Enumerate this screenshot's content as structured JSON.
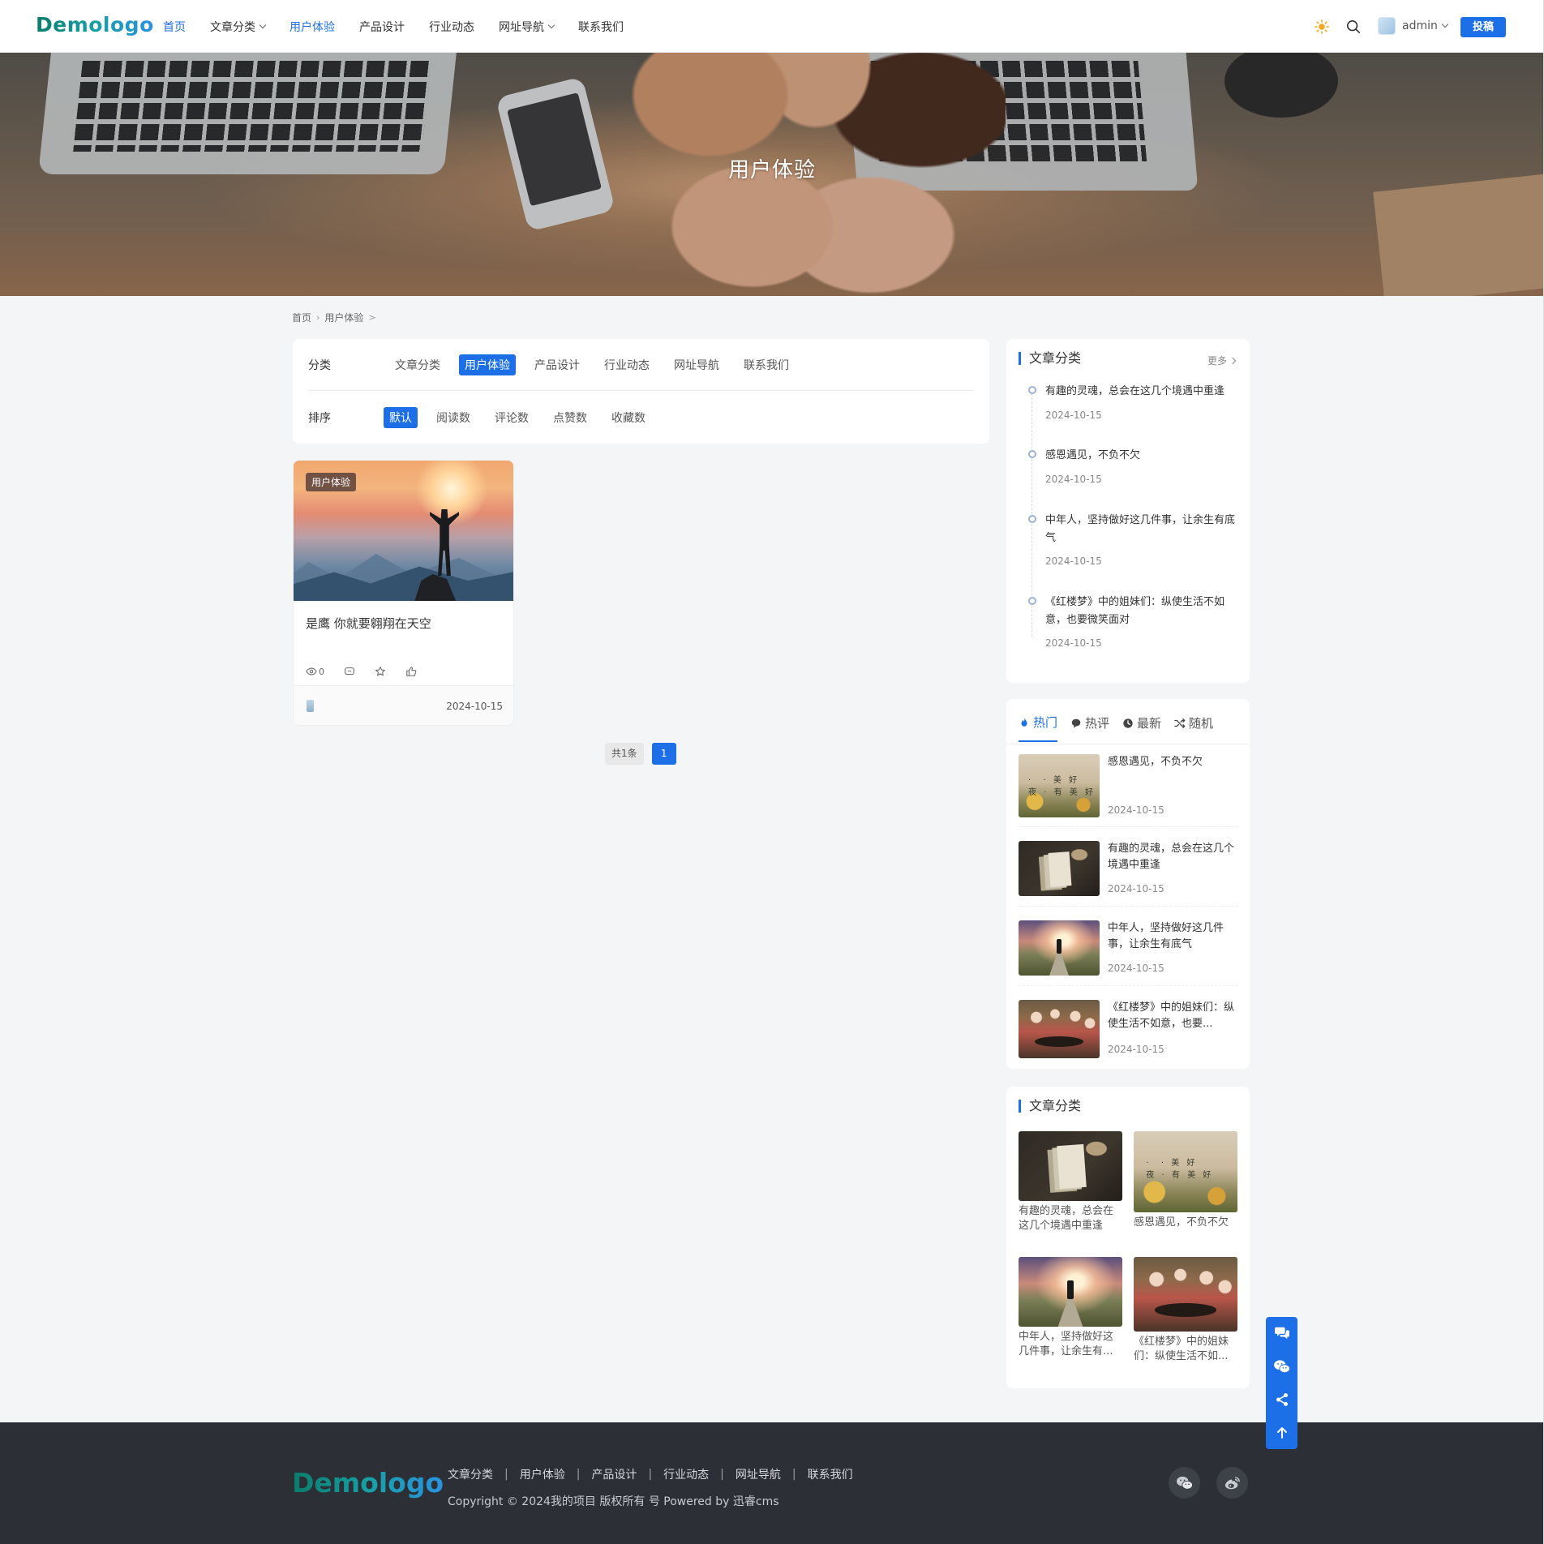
{
  "header": {
    "logo": "Demologo",
    "nav": [
      {
        "label": "首页",
        "active": false,
        "home": true,
        "dropdown": false
      },
      {
        "label": "文章分类",
        "dropdown": true
      },
      {
        "label": "用户体验",
        "active": true,
        "dropdown": false
      },
      {
        "label": "产品设计",
        "dropdown": false
      },
      {
        "label": "行业动态",
        "dropdown": false
      },
      {
        "label": "网址导航",
        "dropdown": true
      },
      {
        "label": "联系我们",
        "dropdown": false
      }
    ],
    "user": "admin",
    "submit": "投稿",
    "icons": [
      "sun-icon",
      "search-icon",
      "avatar",
      "chevron-down-icon"
    ],
    "accent": "#1d6fe8"
  },
  "banner": {
    "title": "用户体验"
  },
  "breadcrumb": {
    "home": "首页",
    "current": "用户体验",
    "trail_sep": ">"
  },
  "filter": {
    "category_label": "分类",
    "categories": [
      "文章分类",
      "用户体验",
      "产品设计",
      "行业动态",
      "网址导航",
      "联系我们"
    ],
    "category_selected": "用户体验",
    "sort_label": "排序",
    "sorts": [
      "默认",
      "阅读数",
      "评论数",
      "点赞数",
      "收藏数"
    ],
    "sort_selected": "默认"
  },
  "article": {
    "tag": "用户体验",
    "title": "是鹰 你就要翱翔在天空",
    "views": "0",
    "date": "2024-10-15"
  },
  "pagination": {
    "total": "共1条",
    "current": "1"
  },
  "sidebar": {
    "category_widget": {
      "title": "文章分类",
      "more": "更多",
      "items": [
        {
          "title": "有趣的灵魂，总会在这几个境遇中重逢",
          "date": "2024-10-15"
        },
        {
          "title": "感恩遇见，不负不欠",
          "date": "2024-10-15"
        },
        {
          "title": "中年人，坚持做好这几件事，让余生有底气",
          "date": "2024-10-15"
        },
        {
          "title": "《红楼梦》中的姐妹们：纵使生活不如意，也要微笑面对",
          "date": "2024-10-15"
        }
      ]
    },
    "tabs_widget": {
      "tabs": [
        "热门",
        "热评",
        "最新",
        "随机"
      ],
      "active": "热门",
      "items": [
        {
          "title": "感恩遇见，不负不欠",
          "date": "2024-10-15",
          "thumb": "sunflower"
        },
        {
          "title": "有趣的灵魂，总会在这几个境遇中重逢",
          "date": "2024-10-15",
          "thumb": "book"
        },
        {
          "title": "中年人，坚持做好这几件事，让余生有底气",
          "date": "2024-10-15",
          "thumb": "road"
        },
        {
          "title": "《红楼梦》中的姐妹们：纵使生活不如意，也要...",
          "date": "2024-10-15",
          "thumb": "drama"
        }
      ]
    },
    "grid_widget": {
      "title": "文章分类",
      "items": [
        {
          "title": "有趣的灵魂，总会在这几个境遇中重逢",
          "thumb": "book"
        },
        {
          "title": "感恩遇见，不负不欠",
          "thumb": "sunflower"
        },
        {
          "title": "中年人，坚持做好这几件事，让余生有...",
          "thumb": "road"
        },
        {
          "title": "《红楼梦》中的姐妹们：纵使生活不如...",
          "thumb": "drama"
        }
      ]
    }
  },
  "float_bar": {
    "icons": [
      "chat-icon",
      "wechat-icon",
      "share-icon",
      "arrow-up-icon"
    ]
  },
  "footer": {
    "logo": "Demologo",
    "links": [
      "文章分类",
      "用户体验",
      "产品设计",
      "行业动态",
      "网址导航",
      "联系我们"
    ],
    "copyright": "Copyright © 2024我的项目 版权所有 号 Powered by 迅睿cms",
    "social_icons": [
      "wechat-icon",
      "weibo-icon"
    ]
  }
}
